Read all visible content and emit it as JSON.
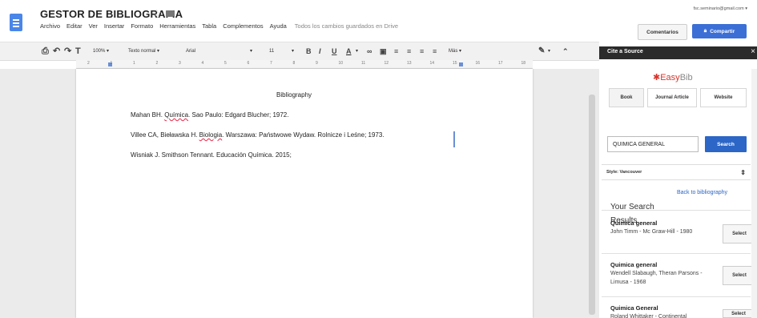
{
  "header": {
    "title": "GESTOR DE BIBLIOGRAFIA",
    "star_icon": "star-icon",
    "folder_icon": "folder-icon",
    "account": "fsc.seminario@gmail.com ▾",
    "comments_label": "Comentarios",
    "share_label": "Compartir"
  },
  "menu": {
    "items": [
      "Archivo",
      "Editar",
      "Ver",
      "Insertar",
      "Formato",
      "Herramientas",
      "Tabla",
      "Complementos",
      "Ayuda"
    ],
    "saved_status": "Todos los cambios guardados en Drive"
  },
  "toolbar": {
    "zoom": "100%",
    "style": "Texto normal",
    "font": "Arial",
    "size": "11",
    "more": "Más"
  },
  "ruler": {
    "ticks": [
      "2",
      "1",
      "1",
      "2",
      "3",
      "4",
      "5",
      "6",
      "7",
      "8",
      "9",
      "10",
      "11",
      "12",
      "13",
      "14",
      "15",
      "16",
      "17",
      "18"
    ]
  },
  "document": {
    "heading": "Bibliography",
    "refs": [
      {
        "pre": "Mahan BH. ",
        "err": "Química",
        "post": ". Sao Paulo: Edgard Blucher; 1972."
      },
      {
        "pre": "Villee CA, Bieławska H. ",
        "err": "Biologia",
        "post": ". Warszawa: Państwowe Wydaw. Rolnicze i Leśne; 1973."
      },
      {
        "pre": "Wisniak J. Smithson Tennant. Educación Química. 2015;",
        "err": "",
        "post": ""
      }
    ]
  },
  "panel": {
    "header": "Cite a Source",
    "close": "×",
    "brand_prefix": "✱",
    "brand_easy": "Easy",
    "brand_bib": "Bib",
    "tabs": [
      "Book",
      "Journal Article",
      "Website"
    ],
    "search_value": "QUIMICA GENERAL",
    "search_button": "Search",
    "style_label": "Style: Vancouver",
    "style_arrow": "⇕",
    "back_link": "Back to bibliography",
    "results_heading": "Your Search Results",
    "results": [
      {
        "title": "Quimica general",
        "sub": "John Timm - Mc Graw-Hill - 1980",
        "select": "Select"
      },
      {
        "title": "Quimica general",
        "sub": "Wendell Slabaugh, Theran Parsons - Limusa - 1968",
        "select": "Select"
      },
      {
        "title": "Quimica General",
        "sub": "Roland Whittaker - Continental",
        "select": "Select"
      }
    ]
  }
}
